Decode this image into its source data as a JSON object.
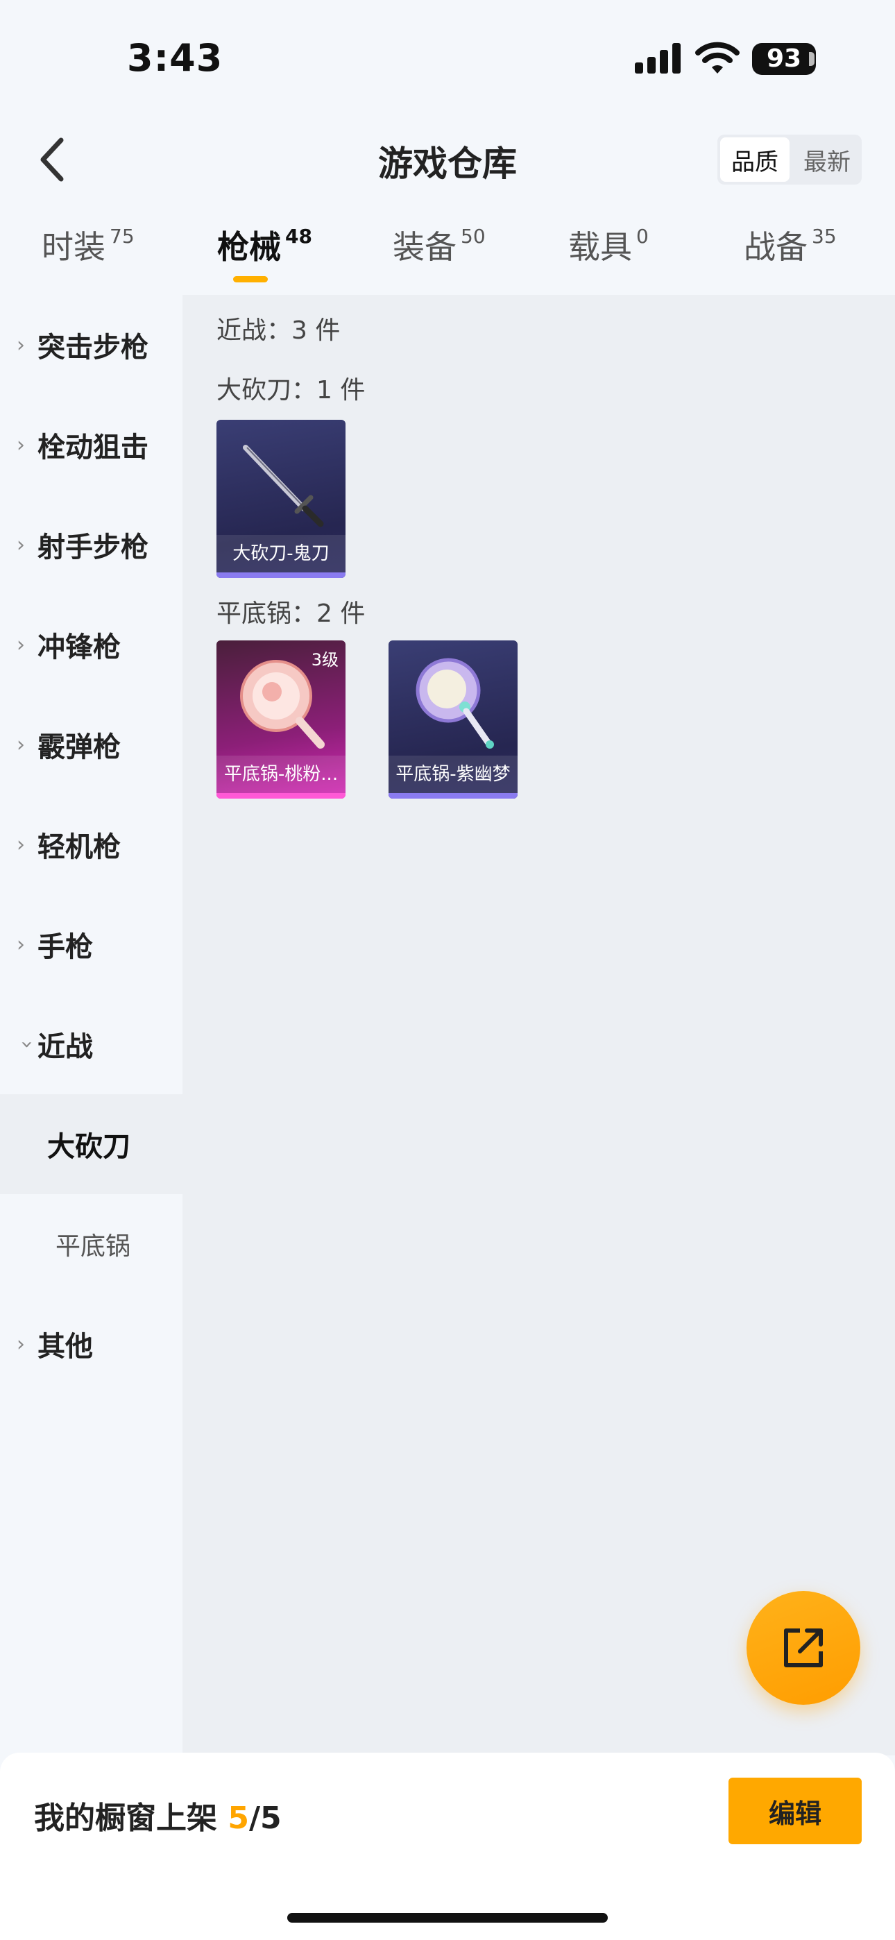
{
  "status": {
    "time": "3:43",
    "battery": "93"
  },
  "header": {
    "title": "游戏仓库",
    "sort_quality": "品质",
    "sort_newest": "最新"
  },
  "tabs": [
    {
      "label": "时装",
      "count": "75"
    },
    {
      "label": "枪械",
      "count": "48"
    },
    {
      "label": "装备",
      "count": "50"
    },
    {
      "label": "载具",
      "count": "0"
    },
    {
      "label": "战备",
      "count": "35"
    }
  ],
  "sidebar": {
    "items": [
      {
        "label": "突击步枪"
      },
      {
        "label": "栓动狙击"
      },
      {
        "label": "射手步枪"
      },
      {
        "label": "冲锋枪"
      },
      {
        "label": "霰弹枪"
      },
      {
        "label": "轻机枪"
      },
      {
        "label": "手枪"
      },
      {
        "label": "近战"
      },
      {
        "label": "大砍刀"
      },
      {
        "label": "平底锅"
      },
      {
        "label": "其他"
      }
    ]
  },
  "content": {
    "category_summary": "近战：3 件",
    "groups": [
      {
        "label": "大砍刀：1 件",
        "items": [
          {
            "name": "大砍刀-鬼刀",
            "level": ""
          }
        ]
      },
      {
        "label": "平底锅：2 件",
        "items": [
          {
            "name": "平底锅-桃粉...",
            "level": "3级"
          },
          {
            "name": "平底锅-紫幽梦",
            "level": ""
          }
        ]
      }
    ]
  },
  "bottom": {
    "shelf_label": "我的橱窗上架",
    "shelf_count": "5",
    "shelf_total": "/5",
    "edit_label": "编辑"
  },
  "colors": {
    "accent": "#ffa800",
    "tab_underline": "#ffb000",
    "rare_purple": "#8a7bf0",
    "rare_pink": "#ff59d6"
  }
}
